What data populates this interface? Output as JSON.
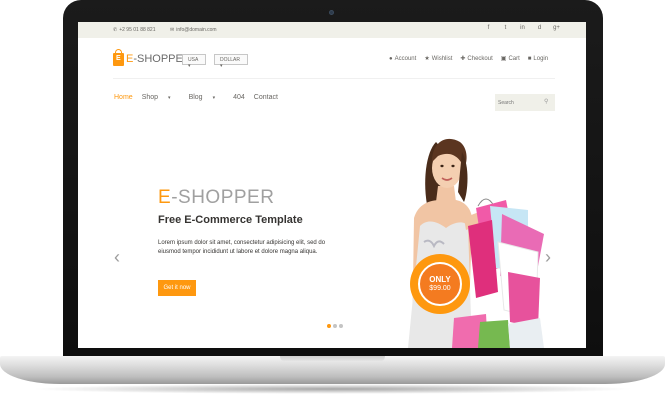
{
  "topbar": {
    "phone": "+2 95 01 88 821",
    "email": "info@domain.com",
    "social": [
      "f",
      "t",
      "in",
      "d",
      "g+"
    ]
  },
  "header": {
    "logo_prefix": "E",
    "logo_text": "-SHOPPER",
    "currency_usa": "USA ▾",
    "currency_dollar": "DOLLAR ▾",
    "account_links": [
      {
        "icon": "user-icon",
        "label": "Account"
      },
      {
        "icon": "star-icon",
        "label": "Wishlist"
      },
      {
        "icon": "crosshair-icon",
        "label": "Checkout"
      },
      {
        "icon": "cart-icon",
        "label": "Cart"
      },
      {
        "icon": "lock-icon",
        "label": "Login"
      }
    ]
  },
  "nav": {
    "home": "Home",
    "shop": "Shop",
    "blog": "Blog",
    "p404": "404",
    "contact": "Contact",
    "search_placeholder": "Search"
  },
  "slider": {
    "title_prefix": "E",
    "title_rest": "-SHOPPER",
    "subtitle": "Free E-Commerce Template",
    "description": "Lorem ipsum dolor sit amet, consectetur adipisicing elit, sed do eiusmod tempor incididunt ut labore et dolore magna aliqua.",
    "button": "Get it now",
    "badge_only": "ONLY",
    "badge_price": "$99.00",
    "active_slide": 1,
    "slide_count": 3
  },
  "colors": {
    "accent": "#fe980f",
    "text": "#696763",
    "topbar_bg": "#f0f0e9"
  }
}
